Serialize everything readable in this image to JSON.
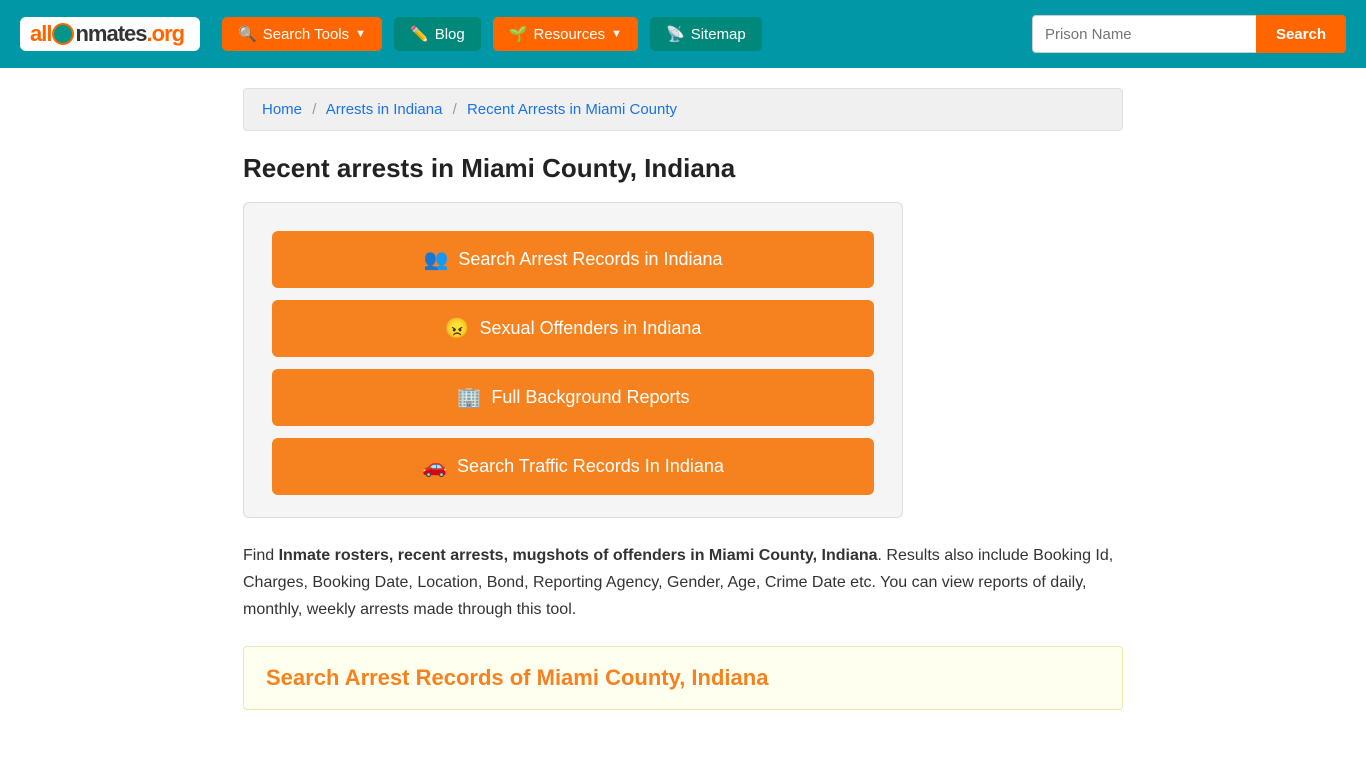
{
  "header": {
    "logo": {
      "part1": "all",
      "part2": "Inmates",
      "part3": ".org"
    },
    "nav": [
      {
        "id": "search-tools",
        "label": "Search Tools",
        "icon": "🔍",
        "dropdown": true
      },
      {
        "id": "blog",
        "label": "Blog",
        "icon": "✏️",
        "dropdown": false
      },
      {
        "id": "resources",
        "label": "Resources",
        "icon": "🌱",
        "dropdown": true
      },
      {
        "id": "sitemap",
        "label": "Sitemap",
        "icon": "📡",
        "dropdown": false
      }
    ],
    "search": {
      "placeholder": "Prison Name",
      "button_label": "Search"
    }
  },
  "breadcrumb": {
    "items": [
      {
        "label": "Home",
        "href": "#"
      },
      {
        "label": "Arrests in Indiana",
        "href": "#"
      },
      {
        "label": "Recent Arrests in Miami County",
        "href": "#"
      }
    ]
  },
  "page_title": "Recent arrests in Miami County, Indiana",
  "action_buttons": [
    {
      "id": "search-arrest",
      "icon": "👥",
      "label": "Search Arrest Records in Indiana"
    },
    {
      "id": "sexual-offenders",
      "icon": "😠",
      "label": "Sexual Offenders in Indiana"
    },
    {
      "id": "background-reports",
      "icon": "🏢",
      "label": "Full Background Reports"
    },
    {
      "id": "traffic-records",
      "icon": "🚗",
      "label": "Search Traffic Records In Indiana"
    }
  ],
  "description": {
    "intro": "Find ",
    "bold_part": "Inmate rosters, recent arrests, mugshots of offenders in Miami County, Indiana",
    "rest": ". Results also include Booking Id, Charges, Booking Date, Location, Bond, Reporting Agency, Gender, Age, Crime Date etc. You can view reports of daily, monthly, weekly arrests made through this tool."
  },
  "section_box": {
    "title": "Search Arrest Records of Miami County, Indiana"
  }
}
